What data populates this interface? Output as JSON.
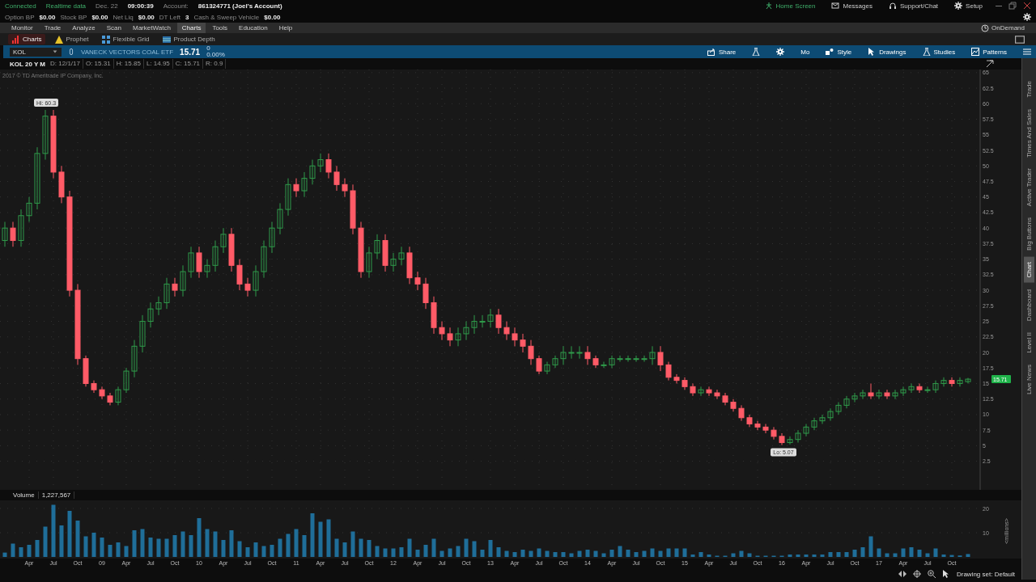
{
  "status_bar": {
    "connection": "Connected",
    "data_feed": "Realtime data",
    "date": "Dec. 22",
    "time": "09:00:39",
    "account_label": "Account:",
    "account": "861324771 (Joel's Account)"
  },
  "top_links": [
    {
      "label": "Home Screen",
      "kind": "home"
    },
    {
      "label": "Messages",
      "kind": "mail"
    },
    {
      "label": "Support/Chat",
      "kind": "headset"
    },
    {
      "label": "Setup",
      "kind": "gear"
    }
  ],
  "balances": [
    {
      "label": "Option BP",
      "value": "$0.00"
    },
    {
      "label": "Stock BP",
      "value": "$0.00"
    },
    {
      "label": "Net Liq",
      "value": "$0.00"
    },
    {
      "label": "DT Left",
      "value": "3"
    },
    {
      "label": "Cash & Sweep Vehicle",
      "value": "$0.00"
    }
  ],
  "menu": [
    {
      "label": "Monitor",
      "selected": false
    },
    {
      "label": "Trade",
      "selected": false
    },
    {
      "label": "Analyze",
      "selected": false
    },
    {
      "label": "Scan",
      "selected": false
    },
    {
      "label": "MarketWatch",
      "selected": false
    },
    {
      "label": "Charts",
      "selected": true
    },
    {
      "label": "Tools",
      "selected": false
    },
    {
      "label": "Education",
      "selected": false
    },
    {
      "label": "Help",
      "selected": false
    }
  ],
  "ondemand": "OnDemand",
  "subtabs": [
    {
      "label": "Charts",
      "kind": "charts",
      "selected": true
    },
    {
      "label": "Prophet",
      "kind": "prophet",
      "selected": false
    },
    {
      "label": "Flexible Grid",
      "kind": "grid",
      "selected": false
    },
    {
      "label": "Product Depth",
      "kind": "depth",
      "selected": false
    }
  ],
  "symbol_bar": {
    "symbol": "KOL",
    "description": "VANECK VECTORS COAL ETF",
    "price": "15.71",
    "change": "0",
    "change_pct": "0.00%"
  },
  "chart_toolbar": [
    {
      "label": "Share",
      "kind": "share"
    },
    {
      "kind": "flask"
    },
    {
      "kind": "gear"
    },
    {
      "label": "Mo",
      "kind": "text"
    },
    {
      "label": "Style",
      "kind": "style"
    },
    {
      "label": "Drawings",
      "kind": "drawings"
    },
    {
      "label": "Studies",
      "kind": "studies"
    },
    {
      "label": "Patterns",
      "kind": "patterns"
    },
    {
      "kind": "menu"
    }
  ],
  "chart_header": {
    "title": "KOL 20 Y M",
    "fields": [
      "D: 12/1/17",
      "O: 15.31",
      "H: 15.85",
      "L: 14.95",
      "C: 15.71",
      "R: 0.9"
    ]
  },
  "price_chart": {
    "copyright": "2017 © TD Ameritrade IP Company, Inc.",
    "hi_label": "Hi: 60.3",
    "lo_label": "Lo: 5.07",
    "last_price": "15.71",
    "chart_data": {
      "type": "candlestick",
      "grid": true,
      "ylim": [
        -2.1,
        65.5
      ],
      "yticks": [
        2.5,
        5,
        7.5,
        10,
        12.5,
        15,
        17.5,
        20,
        22.5,
        25,
        27.5,
        30,
        32.5,
        35,
        37.5,
        40,
        42.5,
        45,
        47.5,
        50,
        52.5,
        55,
        57.5,
        60,
        62.5,
        65
      ],
      "ohlc": [
        [
          38,
          41,
          37,
          40
        ],
        [
          40,
          41,
          37,
          38
        ],
        [
          38,
          43,
          37,
          42
        ],
        [
          42,
          45,
          41,
          44
        ],
        [
          44,
          53,
          43,
          52
        ],
        [
          52,
          59,
          51,
          58
        ],
        [
          58,
          59,
          48,
          49
        ],
        [
          49,
          50,
          44,
          45
        ],
        [
          45,
          46,
          29,
          30
        ],
        [
          30,
          31,
          18,
          19
        ],
        [
          19,
          19.5,
          14.5,
          15
        ],
        [
          15,
          15.5,
          13.5,
          14
        ],
        [
          14,
          14.5,
          12.5,
          13
        ],
        [
          13,
          13.5,
          11.5,
          12
        ],
        [
          12,
          14.5,
          11.5,
          14
        ],
        [
          14,
          17.5,
          13.5,
          17
        ],
        [
          17,
          22,
          16,
          21
        ],
        [
          21,
          26,
          20,
          25
        ],
        [
          25,
          28,
          24,
          27
        ],
        [
          27,
          29,
          26,
          28
        ],
        [
          28,
          32,
          27,
          31
        ],
        [
          31,
          32,
          29,
          30
        ],
        [
          30,
          34,
          29,
          33
        ],
        [
          33,
          37,
          32,
          36
        ],
        [
          36,
          37,
          32,
          33
        ],
        [
          33,
          35,
          32,
          34
        ],
        [
          34,
          38,
          33,
          37
        ],
        [
          37,
          40,
          36,
          39
        ],
        [
          39,
          40,
          33,
          34
        ],
        [
          34,
          35,
          30,
          31
        ],
        [
          31,
          32,
          29,
          30
        ],
        [
          30,
          34,
          29,
          33
        ],
        [
          33,
          38,
          32,
          37
        ],
        [
          37,
          41,
          36,
          40
        ],
        [
          40,
          44,
          39,
          43
        ],
        [
          43,
          48,
          42,
          47
        ],
        [
          47,
          48,
          45,
          46
        ],
        [
          46,
          49,
          45,
          48
        ],
        [
          48,
          51,
          47,
          50
        ],
        [
          50,
          52,
          49,
          51
        ],
        [
          51,
          52,
          48,
          49
        ],
        [
          49,
          50,
          46,
          47
        ],
        [
          47,
          48,
          45,
          46
        ],
        [
          46,
          47,
          39,
          40
        ],
        [
          40,
          41,
          32,
          33
        ],
        [
          33,
          37,
          32,
          36
        ],
        [
          36,
          39,
          35,
          38
        ],
        [
          38,
          39,
          33,
          34
        ],
        [
          34,
          36,
          33,
          35
        ],
        [
          35,
          37,
          34,
          36
        ],
        [
          36,
          37,
          31,
          32
        ],
        [
          32,
          33,
          30,
          31
        ],
        [
          31,
          32,
          27,
          28
        ],
        [
          28,
          29,
          23,
          24
        ],
        [
          24,
          25,
          22,
          23
        ],
        [
          23,
          24,
          21,
          22
        ],
        [
          22,
          24,
          21,
          23
        ],
        [
          23,
          25,
          22,
          24
        ],
        [
          24,
          26,
          23,
          25
        ],
        [
          25,
          26,
          24,
          25
        ],
        [
          25,
          27,
          24,
          26
        ],
        [
          26,
          27,
          23,
          24
        ],
        [
          24,
          25,
          22,
          23
        ],
        [
          23,
          24,
          21,
          22
        ],
        [
          22,
          23,
          20,
          21
        ],
        [
          21,
          22,
          18,
          19
        ],
        [
          19,
          19.5,
          16.5,
          17
        ],
        [
          17,
          18.5,
          16.5,
          18
        ],
        [
          18,
          19.5,
          17.5,
          19
        ],
        [
          19,
          21,
          18,
          20
        ],
        [
          20,
          21,
          19,
          20
        ],
        [
          20,
          21,
          19,
          20
        ],
        [
          20,
          21,
          18,
          19
        ],
        [
          19,
          19.5,
          17.5,
          18
        ],
        [
          18,
          18.5,
          17.5,
          18
        ],
        [
          18,
          19.5,
          17.5,
          19
        ],
        [
          19,
          19.5,
          18.5,
          19
        ],
        [
          19,
          19.5,
          18.5,
          19
        ],
        [
          19,
          19.5,
          18.5,
          19
        ],
        [
          19,
          19.5,
          18.5,
          19
        ],
        [
          19,
          21,
          18,
          20
        ],
        [
          20,
          21,
          17,
          18
        ],
        [
          18,
          18.5,
          15.5,
          16
        ],
        [
          16,
          16.5,
          15,
          15.5
        ],
        [
          15.5,
          16,
          14,
          14.5
        ],
        [
          14.5,
          15,
          13,
          13.5
        ],
        [
          13.5,
          14.5,
          13,
          14
        ],
        [
          14,
          14.5,
          13,
          13.5
        ],
        [
          13.5,
          14,
          12.5,
          13
        ],
        [
          13,
          13.5,
          11.5,
          12
        ],
        [
          12,
          12.5,
          10.5,
          11
        ],
        [
          11,
          11.5,
          9,
          9.5
        ],
        [
          9.5,
          10,
          8,
          8.5
        ],
        [
          8.5,
          9,
          7.5,
          8
        ],
        [
          8,
          8.5,
          7,
          7.5
        ],
        [
          7.5,
          8,
          6,
          6.5
        ],
        [
          6.5,
          7,
          5.1,
          5.5
        ],
        [
          5.5,
          6.5,
          5.2,
          6
        ],
        [
          6,
          7.5,
          5.5,
          7
        ],
        [
          7,
          8.5,
          6.5,
          8
        ],
        [
          8,
          9.5,
          7.5,
          9
        ],
        [
          9,
          10,
          8.5,
          9.5
        ],
        [
          9.5,
          11,
          9,
          10.5
        ],
        [
          10.5,
          12,
          10,
          11.5
        ],
        [
          11.5,
          13,
          11,
          12.5
        ],
        [
          12.5,
          13.5,
          12,
          13
        ],
        [
          13,
          14,
          12.5,
          13.5
        ],
        [
          13.5,
          15,
          12.5,
          13
        ],
        [
          13,
          14,
          12.5,
          13.5
        ],
        [
          13.5,
          14,
          12.5,
          13
        ],
        [
          13,
          14,
          12.5,
          13.5
        ],
        [
          13.5,
          14.5,
          13,
          14
        ],
        [
          14,
          15,
          13.5,
          14.5
        ],
        [
          14.5,
          15,
          13.5,
          14
        ],
        [
          14,
          14.5,
          13.5,
          14
        ],
        [
          14,
          15.5,
          13.5,
          15
        ],
        [
          15,
          16,
          14.5,
          15.5
        ],
        [
          15.5,
          16,
          14.5,
          15
        ],
        [
          15,
          16,
          14.5,
          15.5
        ],
        [
          15.3,
          15.9,
          15,
          15.7
        ]
      ]
    }
  },
  "volume": {
    "title": "Volume",
    "reading": "1,227,567",
    "chart_data": {
      "type": "bar",
      "grid": true,
      "ylabel": "<millions>",
      "ylim": [
        0,
        22
      ],
      "yticks": [
        10,
        20
      ],
      "categories": [
        null,
        null,
        null,
        "Apr",
        null,
        null,
        "Jul",
        null,
        null,
        "Oct",
        null,
        null,
        "09",
        null,
        null,
        "Apr",
        null,
        null,
        "Jul",
        null,
        null,
        "Oct",
        null,
        null,
        "10",
        null,
        null,
        "Apr",
        null,
        null,
        "Jul",
        null,
        null,
        "Oct",
        null,
        null,
        "11",
        null,
        null,
        "Apr",
        null,
        null,
        "Jul",
        null,
        null,
        "Oct",
        null,
        null,
        "12",
        null,
        null,
        "Apr",
        null,
        null,
        "Jul",
        null,
        null,
        "Oct",
        null,
        null,
        "13",
        null,
        null,
        "Apr",
        null,
        null,
        "Jul",
        null,
        null,
        "Oct",
        null,
        null,
        "14",
        null,
        null,
        "Apr",
        null,
        null,
        "Jul",
        null,
        null,
        "Oct",
        null,
        null,
        "15",
        null,
        null,
        "Apr",
        null,
        null,
        "Jul",
        null,
        null,
        "Oct",
        null,
        null,
        "16",
        null,
        null,
        "Apr",
        null,
        null,
        "Jul",
        null,
        null,
        "Oct",
        null,
        null,
        "17",
        null,
        null,
        "Apr",
        null,
        null,
        "Jul",
        null,
        null,
        "Oct",
        null,
        null
      ],
      "values": [
        1.8,
        5.5,
        4,
        5,
        7,
        12.5,
        21.5,
        13,
        19,
        15,
        8.5,
        10,
        8,
        5,
        6,
        4.5,
        11,
        11.5,
        8,
        7.5,
        7.5,
        9,
        10.5,
        9,
        16,
        11.5,
        10.5,
        7,
        11,
        6.5,
        4,
        6,
        4.5,
        5,
        7.5,
        9.5,
        11.5,
        9,
        18,
        14.5,
        15.5,
        7.5,
        6,
        10.5,
        7.5,
        7,
        4.5,
        3.5,
        3.5,
        4,
        7.5,
        3,
        5,
        7.5,
        2.5,
        3.5,
        4.5,
        7.5,
        6.5,
        3,
        7,
        4,
        2.5,
        2,
        3,
        2.5,
        3.5,
        2.5,
        2,
        2,
        1.5,
        2.5,
        3,
        2.5,
        1.5,
        3,
        4.5,
        3,
        2,
        2.5,
        3.5,
        2.5,
        3.5,
        3.5,
        3.5,
        1,
        2,
        1,
        0.5,
        0.5,
        1.5,
        2.5,
        1.5,
        0.5,
        0.5,
        0.5,
        0.5,
        1,
        1,
        1,
        1,
        1,
        2,
        2,
        2,
        3,
        4,
        8.5,
        3.5,
        1.5,
        1.5,
        3.5,
        4,
        3,
        1.5,
        3.5,
        1,
        0.8,
        0.6,
        1.2
      ]
    }
  },
  "bottom_bar": {
    "drawing_set": "Drawing set: Default"
  },
  "side_tabs": [
    {
      "label": "Trade",
      "selected": false
    },
    {
      "label": "Times And Sales",
      "selected": false
    },
    {
      "label": "Active Trader",
      "selected": false
    },
    {
      "label": "Big Buttons",
      "selected": false
    },
    {
      "label": "Chart",
      "selected": true
    },
    {
      "label": "Dashboard",
      "selected": false
    },
    {
      "label": "Level II",
      "selected": false
    },
    {
      "label": "Live News",
      "selected": false
    }
  ]
}
